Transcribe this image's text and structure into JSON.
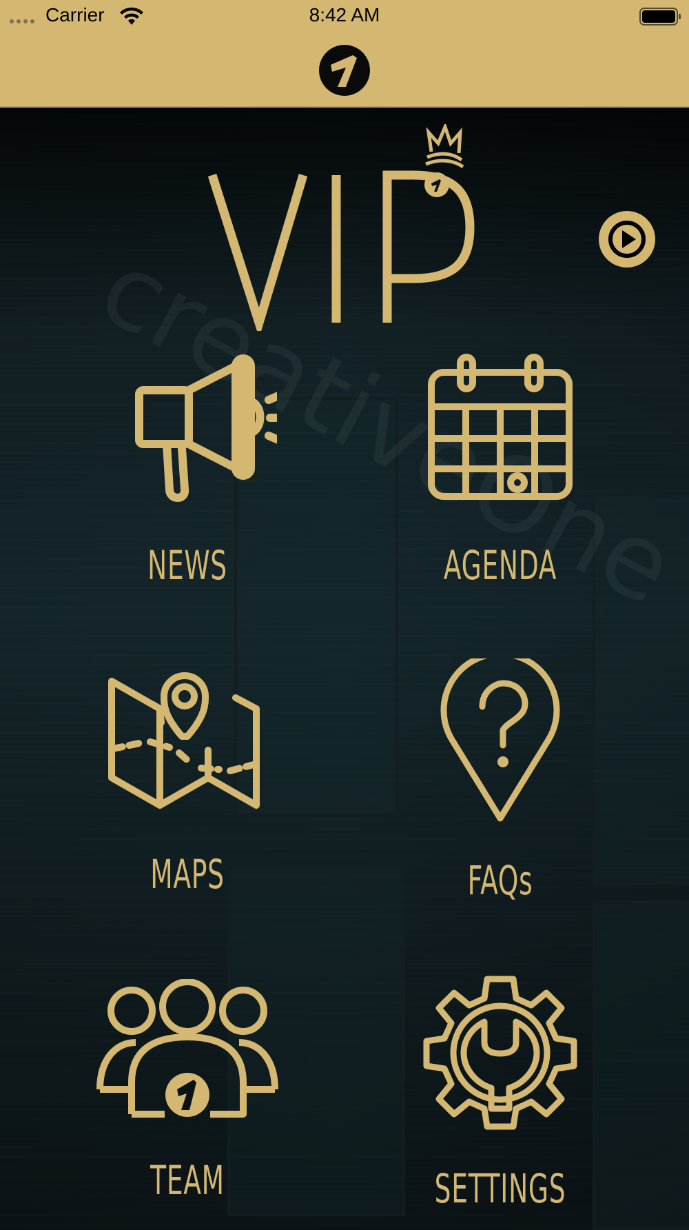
{
  "status_bar": {
    "carrier": "Carrier",
    "time": "8:42 AM"
  },
  "header": {
    "logo_icon": "brand-1-icon"
  },
  "hero": {
    "logo_text": "VIP",
    "background_watermark": "creativeOne",
    "play_icon": "play-icon"
  },
  "tiles": [
    {
      "label": "NEWS",
      "icon": "megaphone-icon"
    },
    {
      "label": "AGENDA",
      "icon": "calendar-icon"
    },
    {
      "label": "MAPS",
      "icon": "map-icon"
    },
    {
      "label": "FAQs",
      "icon": "question-pin-icon"
    },
    {
      "label": "TEAM",
      "icon": "team-icon"
    },
    {
      "label": "SETTINGS",
      "icon": "gear-wrench-icon"
    }
  ],
  "colors": {
    "accent_gold": "#d4b872",
    "background_dark": "#0b1214"
  }
}
